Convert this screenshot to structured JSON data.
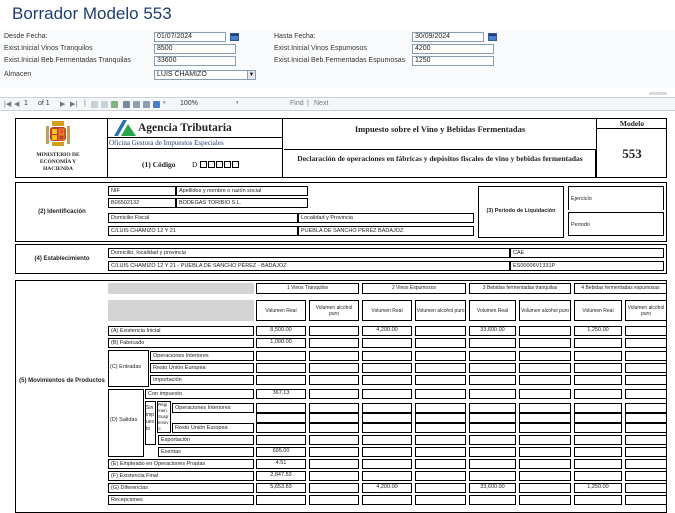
{
  "page": {
    "title": "Borrador Modelo 553"
  },
  "params": {
    "desde_label": "Desde Fecha:",
    "desde_value": "01/07/2024",
    "hasta_label": "Hasta Fecha:",
    "hasta_value": "30/09/2024",
    "vinos_tranq_label": "Exist.Inicial Vinos Tranquilos",
    "vinos_tranq_value": "8500",
    "vinos_esp_label": "Exist.Inicial Vinos Espumosos",
    "vinos_esp_value": "4200",
    "beb_tranq_label": "Exist.Inicial Beb.Fermentadas Tranquilas",
    "beb_tranq_value": "33600",
    "beb_esp_label": "Exist.Inicial Beb.Fermentadas Espumosas",
    "beb_esp_value": "1250",
    "almacen_label": "Almacen",
    "almacen_value": "LUIS CHAMIZO"
  },
  "toolbar": {
    "page_current": "1",
    "page_of": "of 1",
    "zoom": "100%",
    "find_label": "Find",
    "next_label": "Next",
    "separator": "|"
  },
  "report": {
    "ministry": "MINISTERIO DE ECONOMÍA Y HACIENDA",
    "agency": "Agencia Tributaria",
    "office": "Oficina Gestora de Impuestos Especiales",
    "code_label": "(1) Código",
    "code_letter": "D",
    "tax_title": "Impuesto sobre el Vino y Bebidas Fermentadas",
    "decl_title": "Declaración de operaciones en fábricas y depósitos fiscales de vino y bebidas fermentadas",
    "modelo_label": "Modelo",
    "modelo_number": "553",
    "ident_label": "(2) Identificación",
    "nif_label": "NIF",
    "name_label": "Apellidos y nombre o razón social",
    "nif_value": "B06502132",
    "name_value": "BODEGAS TORIBIO S.L.",
    "domicilio_label": "Domicilio Fiscal",
    "localidad_label": "Localidad y Provincia",
    "domicilio_value": "C/LUIS CHAMIZO 12 Y 21",
    "localidad_value": "PUEBLA DE SANCHO PEREZ BADAJOZ",
    "periodo_label": "(3) Periodo de Liquidación",
    "ejercicio_label": "Ejercicio",
    "periodo_small_label": "Periodo",
    "estab_label": "(4) Establecimiento",
    "estab_dom_label": "Domicilio, localidad y provincia",
    "estab_dom_value": "C/LUIS CHAMIZO 12 Y 21 - PUEBLA DE SANCHO PÉREZ - BADAJOZ",
    "cae_label": "CAE",
    "cae_value": "ES00006V1331P",
    "mov_label": "(5) Movimientos de Productos",
    "col_groups": [
      "1 Vinos Tranquilos",
      "2 Vinos Espumosos",
      "3 Bebidas fermentadas tranquilas",
      "4 Bebidas fermentadas espumosas"
    ],
    "col_vol_real": "Volumen Real",
    "col_vol_alc": "Volumen alcohol puro",
    "rows": {
      "a": "(A) Existencia Inicial",
      "b": "(B) Fabricado",
      "c": "(C) Entradas",
      "c1": "Operaciones Interiores",
      "c2": "Resto Unión Europea",
      "c3": "Importación",
      "d": "(D) Salidas",
      "d_con": "Con impuesto",
      "d_sin": "Sin impuesto",
      "d_reg": "Régimen Suspensivo",
      "d1": "Operaciones Interiores",
      "d2": "Resto Unión Europea",
      "d3": "Exportación",
      "d_exentas": "Exentas",
      "e": "(E) Empleado en Operaciones Propias",
      "f": "(F) Existencia Final",
      "g": "(G) Diferencias",
      "h": "Recepciones"
    },
    "values": {
      "a_vt": "8,500.00",
      "a_ve": "4,200.00",
      "a_bt": "33,600.00",
      "a_be": "1,250.00",
      "b_vt": "1,090.00",
      "dcon_vt": "367.13",
      "dexe_vt": "695.00",
      "e_vt": "4.51",
      "f_vt": "2,847.53",
      "g_vt": "5,653.83",
      "g_ve": "4,200.00",
      "g_bt": "33,600.00",
      "g_be": "1,250.00"
    }
  }
}
